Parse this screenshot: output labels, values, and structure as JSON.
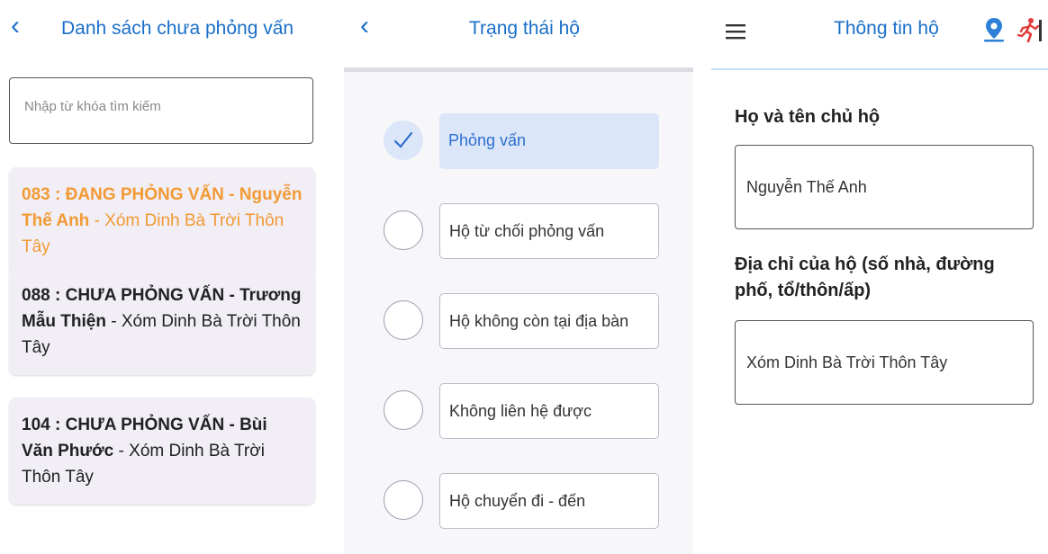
{
  "list_screen": {
    "title": "Danh sách chưa phỏng vấn",
    "back_glyph": "‹",
    "search_placeholder": "Nhập từ khóa tìm kiếm",
    "items": [
      {
        "code": "083",
        "status": "ĐANG PHỎNG VẤN",
        "name": "Nguyễn Thế Anh",
        "address": "Xóm Dinh Bà Trời Thôn Tây",
        "active": true,
        "color": "#f29a33"
      },
      {
        "code": "088",
        "status": "CHƯA PHỎNG VẤN",
        "name": "Trương Mẫu Thiện",
        "address": "Xóm Dinh Bà Trời Thôn Tây",
        "active": false
      },
      {
        "code": "104",
        "status": "CHƯA PHỎNG VẤN",
        "name": "Bùi Văn Phước",
        "address": "Xóm Dinh Bà Trời Thôn Tây",
        "active": false
      }
    ]
  },
  "status_screen": {
    "title": "Trạng thái hộ",
    "back_glyph": "‹",
    "selected_index": 0,
    "options": [
      "Phỏng vấn",
      "Hộ từ chối phỏng vấn",
      "Hộ không còn tại địa bàn",
      "Không liên hệ được",
      "Hộ chuyển đi - đến"
    ]
  },
  "info_screen": {
    "title": "Thông tin hộ",
    "menu_icon": "hamburger-menu-icon",
    "location_icon": "map-pin-icon",
    "exit_icon": "running-person-exit-icon",
    "head_name_label": "Họ và tên chủ hộ",
    "head_name_value": "Nguyễn Thế Anh",
    "address_label": "Địa chỉ của hộ (số nhà, đường phố, tổ/thôn/ấp)",
    "address_value": "Xóm Dinh Bà Trời Thôn Tây"
  },
  "colors": {
    "accent_blue": "#1a6fc9",
    "active_orange": "#f29a33",
    "selected_bg": "#dbe6f8",
    "exit_red": "#e23b3b"
  }
}
